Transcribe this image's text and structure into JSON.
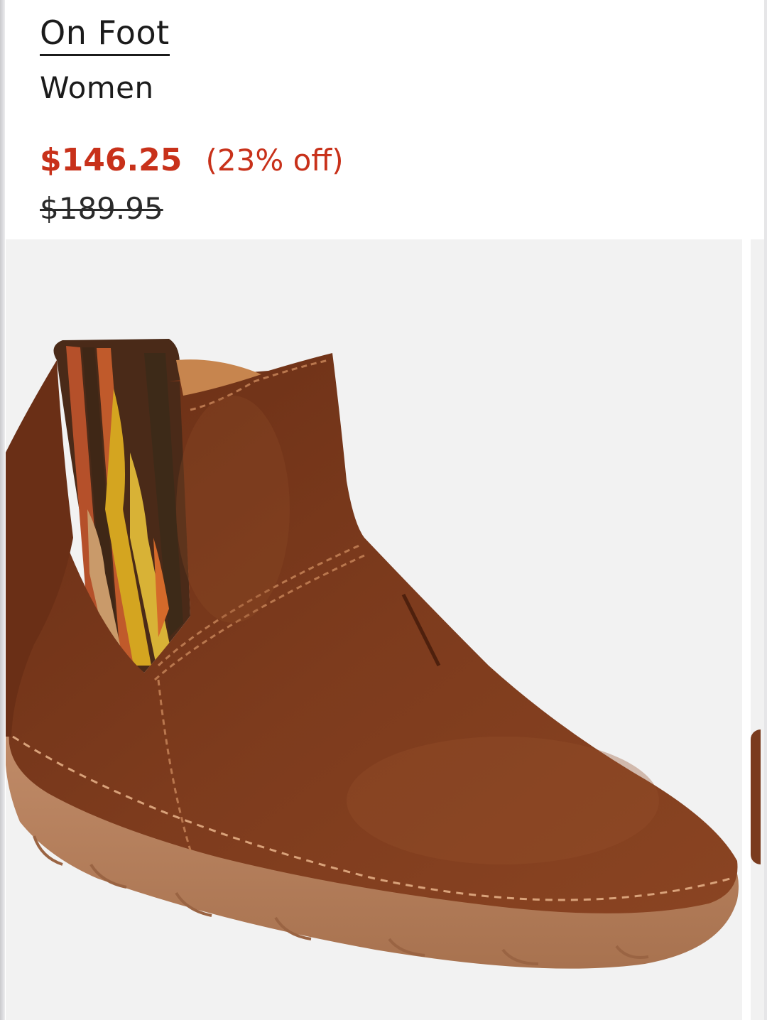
{
  "product": {
    "brand": "On Foot",
    "category": "Women",
    "sale_price": "$146.25",
    "discount": "(23% off)",
    "original_price": "$189.95"
  },
  "gallery": {
    "main_image": "brown-suede-ankle-boot-photo",
    "colors": {
      "suede": "#7b3a1d",
      "sole": "#b98360",
      "sale_red": "#c8311a"
    }
  }
}
